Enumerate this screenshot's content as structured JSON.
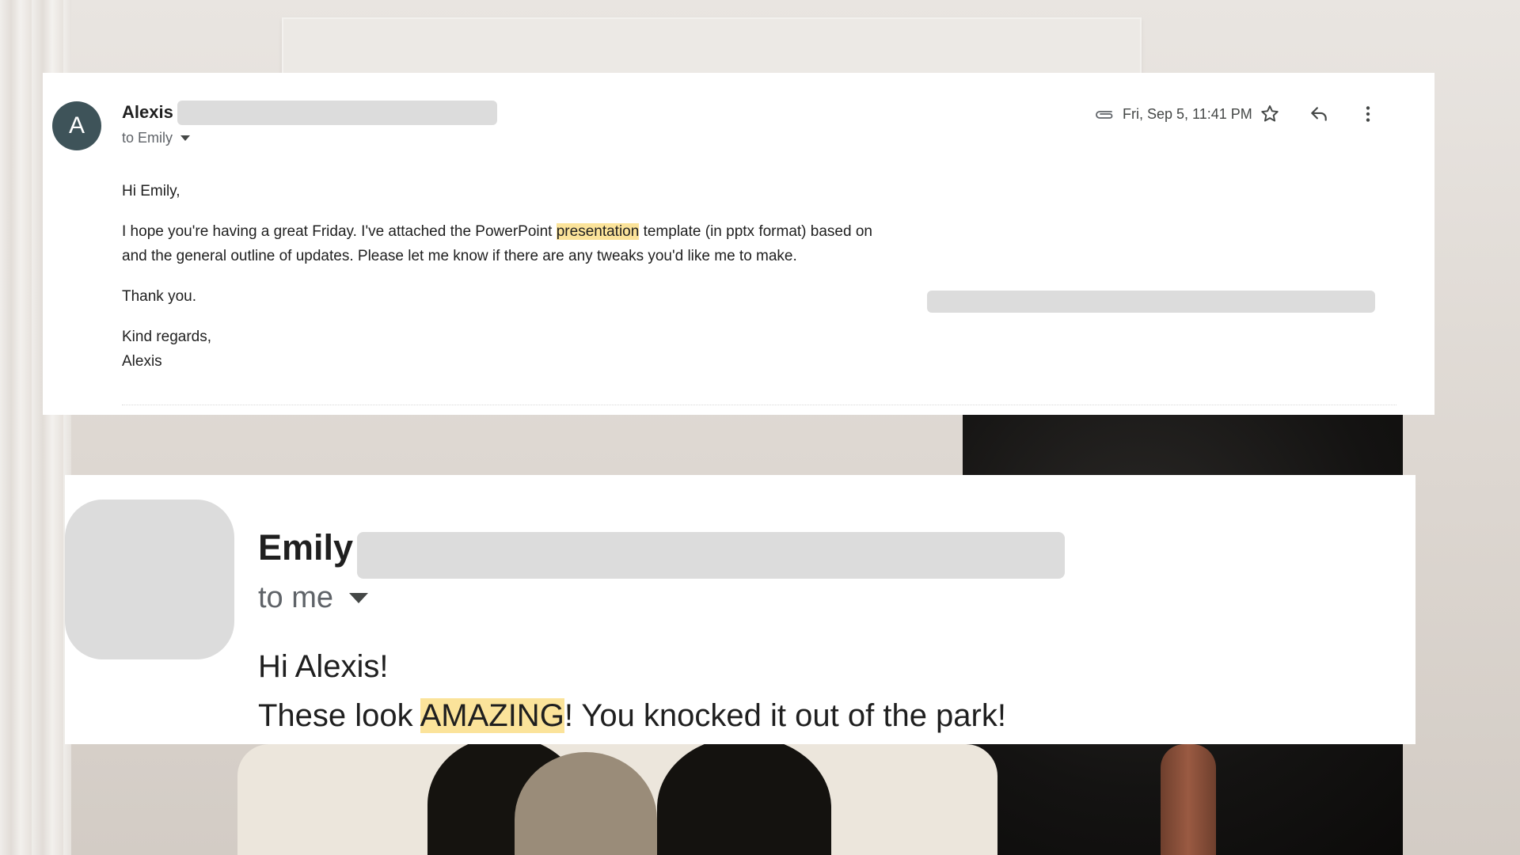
{
  "email1": {
    "avatar_letter": "A",
    "sender_name": "Alexis",
    "recipient": "to Emily",
    "date": "Fri, Sep 5, 11:41 PM",
    "body": {
      "greeting": "Hi Emily,",
      "line1_before": "I hope you're having a great Friday. I've attached the PowerPoint ",
      "line1_highlight": "presentation",
      "line1_after": " template (in pptx format) based on",
      "line2": "and the general outline of updates. Please let me know if there are any tweaks you'd like me to make.",
      "thanks": "Thank you.",
      "closing": "Kind regards,",
      "signature": "Alexis"
    },
    "icons": {
      "attachment": "paperclip-icon",
      "star": "star-icon",
      "reply": "reply-icon",
      "more": "more-vertical-icon"
    },
    "colors": {
      "avatar_bg": "#3e5359",
      "highlight": "#fbe39a"
    }
  },
  "email2": {
    "sender_name": "Emily",
    "recipient": "to me",
    "greeting": "Hi Alexis!",
    "message_before": "These look ",
    "message_highlight": "AMAZING",
    "message_after": "! You knocked it out of the park!"
  }
}
